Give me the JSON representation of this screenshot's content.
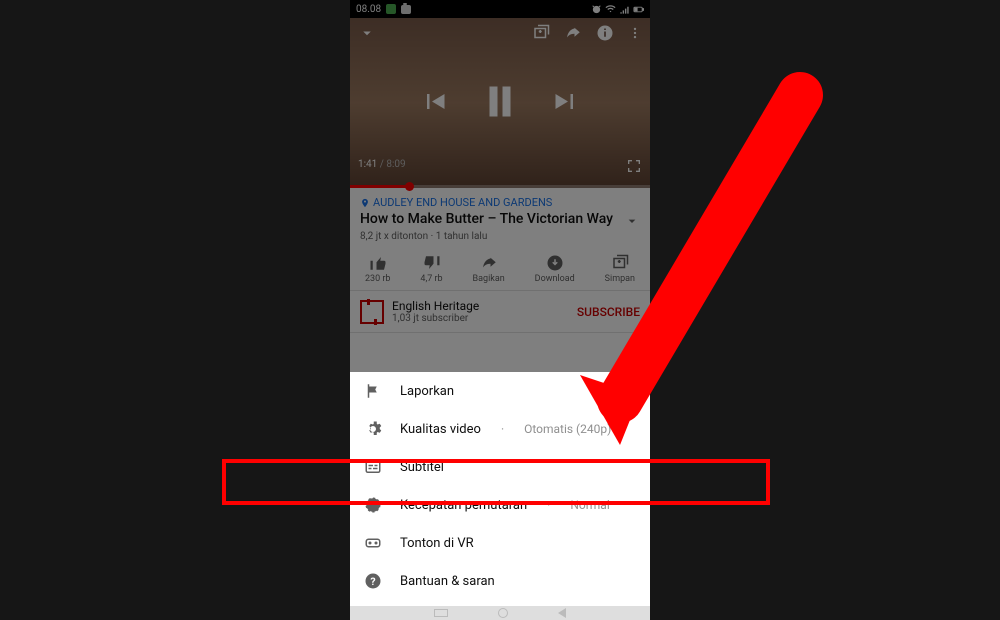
{
  "statusbar": {
    "time": "08.08"
  },
  "video": {
    "current_time": "1:41",
    "total_time": "8:09",
    "location": "AUDLEY END HOUSE AND GARDENS",
    "title": "How to Make Butter – The Victorian Way",
    "views_age": "8,2 jt x ditonton · 1 tahun lalu"
  },
  "actions": {
    "like": "230 rb",
    "dislike": "4,7 rb",
    "share": "Bagikan",
    "download": "Download",
    "save": "Simpan"
  },
  "channel": {
    "name": "English Heritage",
    "subs": "1,03 jt subscriber",
    "subscribe": "SUBSCRIBE"
  },
  "menu": {
    "report": "Laporkan",
    "quality_label": "Kualitas video",
    "quality_value": "Otomatis (240p)",
    "subtitle": "Subtitel",
    "speed_label": "Kecepatan pemutaran",
    "speed_value": "Normal",
    "vr": "Tonton di VR",
    "help": "Bantuan & saran"
  }
}
